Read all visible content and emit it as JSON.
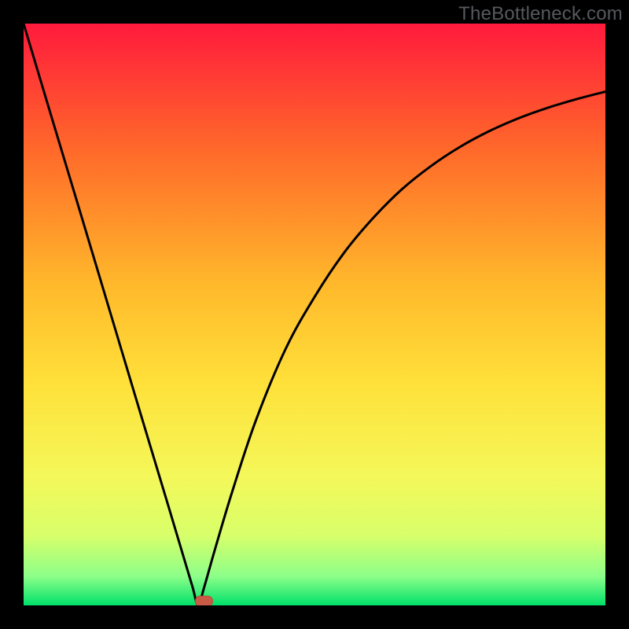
{
  "watermark": "TheBottleneck.com",
  "colors": {
    "frame": "#000000",
    "gradient_top": "#ff1a3c",
    "gradient_mid1": "#ff6a2a",
    "gradient_mid2": "#ffb92b",
    "gradient_mid3": "#ffe13a",
    "gradient_mid4": "#f4f85a",
    "gradient_low1": "#d8ff6a",
    "gradient_low2": "#8cff89",
    "gradient_bottom": "#00e06a",
    "curve": "#000000",
    "marker_fill": "#c95b46",
    "marker_stroke": "#b84a38"
  },
  "chart_data": {
    "type": "line",
    "title": "",
    "xlabel": "",
    "ylabel": "",
    "xlim": [
      0,
      100
    ],
    "ylim": [
      0,
      100
    ],
    "series": [
      {
        "name": "bottleneck-curve",
        "x": [
          0,
          5,
          10,
          15,
          20,
          25,
          27,
          29,
          30,
          31,
          33,
          36,
          40,
          45,
          50,
          55,
          60,
          65,
          70,
          75,
          80,
          85,
          90,
          95,
          100
        ],
        "values": [
          100,
          83.3,
          66.7,
          50,
          33.3,
          16.7,
          10,
          3.3,
          0,
          3,
          10,
          20,
          32,
          44,
          53,
          60.5,
          66.5,
          71.5,
          75.5,
          78.8,
          81.5,
          83.7,
          85.5,
          87,
          88.3
        ]
      }
    ],
    "marker": {
      "x": 31,
      "y": 0.8
    }
  }
}
